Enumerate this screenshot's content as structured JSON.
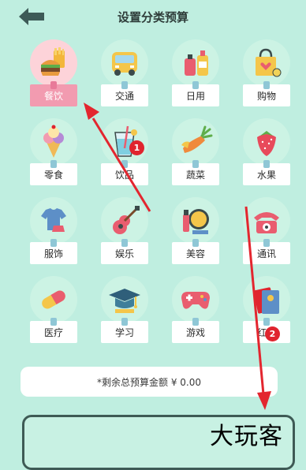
{
  "header": {
    "title": "设置分类预算"
  },
  "categories": [
    {
      "label": "餐饮",
      "icon": "burger-fries-icon",
      "selected": true
    },
    {
      "label": "交通",
      "icon": "bus-icon"
    },
    {
      "label": "日用",
      "icon": "toiletries-icon"
    },
    {
      "label": "购物",
      "icon": "shopping-bag-icon"
    },
    {
      "label": "零食",
      "icon": "ice-cream-icon"
    },
    {
      "label": "饮品",
      "icon": "drink-icon"
    },
    {
      "label": "蔬菜",
      "icon": "carrot-icon"
    },
    {
      "label": "水果",
      "icon": "strawberry-icon"
    },
    {
      "label": "服饰",
      "icon": "tshirt-icon"
    },
    {
      "label": "娱乐",
      "icon": "guitar-icon"
    },
    {
      "label": "美容",
      "icon": "cosmetics-icon"
    },
    {
      "label": "通讯",
      "icon": "telephone-icon"
    },
    {
      "label": "医疗",
      "icon": "pill-icon"
    },
    {
      "label": "学习",
      "icon": "graduation-cap-icon"
    },
    {
      "label": "游戏",
      "icon": "gamepad-icon"
    },
    {
      "label": "红包",
      "icon": "red-envelope-icon"
    }
  ],
  "summary": {
    "text": "*剩余总预算金额 ¥ 0.00"
  },
  "annotations": {
    "badge1": "1",
    "badge2": "2"
  },
  "watermark": "大玩客",
  "colors": {
    "background": "#bfeee0",
    "selected": "#f29bb0",
    "arrow": "#e3262f"
  }
}
